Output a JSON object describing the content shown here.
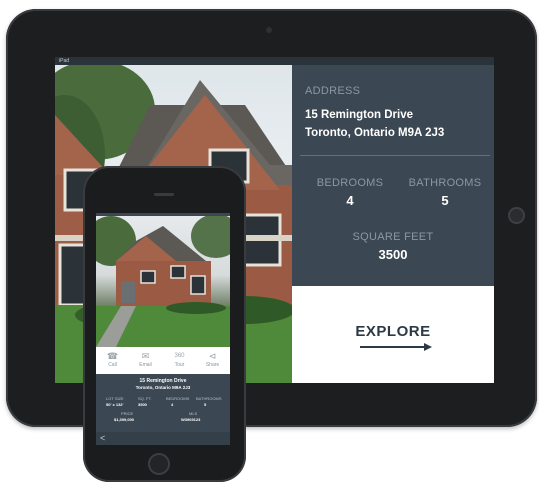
{
  "ipad": {
    "status_left": "iPad",
    "address_label": "ADDRESS",
    "address_line1": "15 Remington Drive",
    "address_line2": "Toronto, Ontario M9A 2J3",
    "bedrooms_label": "BEDROOMS",
    "bedrooms_value": "4",
    "bathrooms_label": "BATHROOMS",
    "bathrooms_value": "5",
    "sqft_label": "SQUARE FEET",
    "sqft_value": "3500",
    "explore_label": "EXPLORE"
  },
  "phone": {
    "actions": [
      {
        "label": "Call",
        "icon": "phone-icon"
      },
      {
        "label": "Email",
        "icon": "mail-icon"
      },
      {
        "label": "Tour",
        "icon": "360-tour-icon"
      },
      {
        "label": "Share",
        "icon": "share-icon"
      }
    ],
    "address_line1": "15 Remington Drive",
    "address_line2": "Toronto, Ontario M9A 2J3",
    "stats": [
      {
        "label": "LOT SIZE",
        "value": "50' x 132'"
      },
      {
        "label": "SQ. FT.",
        "value": "3500"
      },
      {
        "label": "BEDROOMS",
        "value": "4"
      },
      {
        "label": "BATHROOMS",
        "value": "5"
      }
    ],
    "price_label": "PRICE",
    "price_value": "$1,399,000",
    "mls_label": "MLS",
    "mls_value": "W3969123",
    "back_label": "<"
  },
  "colors": {
    "panel": "#3b4853",
    "accent_text": "#8b97a2",
    "explore_text": "#2d3a45"
  }
}
